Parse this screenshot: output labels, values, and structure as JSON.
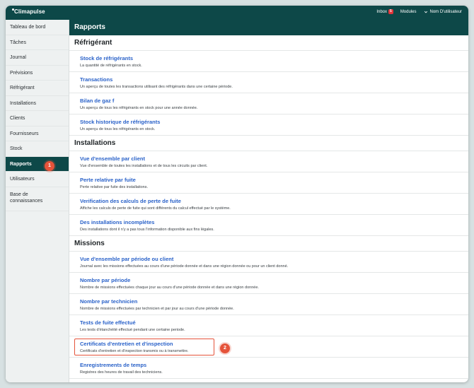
{
  "app": {
    "logo": "Climapulse"
  },
  "topnav": {
    "inbox_label": "Inbox",
    "inbox_count": "5",
    "modules_label": "Modules",
    "user_label": "Nom D'utilisateur"
  },
  "sidebar": {
    "items": [
      {
        "label": "Tableau de bord"
      },
      {
        "label": "Tâches"
      },
      {
        "label": "Journal"
      },
      {
        "label": "Prévisions"
      },
      {
        "label": "Réfrigérant"
      },
      {
        "label": "Installations"
      },
      {
        "label": "Clients"
      },
      {
        "label": "Fournisseurs"
      },
      {
        "label": "Stock"
      },
      {
        "label": "Rapports"
      },
      {
        "label": "Utilisateurs"
      },
      {
        "label_line1": "Base de",
        "label_line2": "connaissances"
      }
    ]
  },
  "markers": {
    "one": "1",
    "two": "2"
  },
  "main": {
    "title": "Rapports",
    "sections": [
      {
        "title": "Réfrigérant",
        "reports": [
          {
            "title": "Stock de réfrigérants",
            "desc": "La quantité de réfrigérants en stock."
          },
          {
            "title": "Transactions",
            "desc": "Un aperçu de toutes les transactions utilisant des réfrigérants dans une certaine période."
          },
          {
            "title": "Bilan de gaz f",
            "desc": "Un aperçu de tous les réfrigérants en stock pour une année donnée."
          },
          {
            "title": "Stock historique de réfrigérants",
            "desc": "Un aperçu de tous les réfrigérants en stock."
          }
        ]
      },
      {
        "title": "Installations",
        "reports": [
          {
            "title": "Vue d'ensemble par client",
            "desc": "Vue d'ensemble de toutes les installations et de tous les circuits par client."
          },
          {
            "title": "Perte relative par fuite",
            "desc": "Perte relative par fuite des installations."
          },
          {
            "title": "Verification des calculs de perte de fuite",
            "desc": "Affiche les calculs de perte de fuite qui sont différents du calcul effectué par le système."
          },
          {
            "title": "Des installations incomplètes",
            "desc": "Des installations dont il n'y a pas tous l'information disponible aux fins légales."
          }
        ]
      },
      {
        "title": "Missions",
        "reports": [
          {
            "title": "Vue d'ensemble par période ou client",
            "desc": "Journal avec les missions effectuées au cours d'une période donnée et dans une région donnée ou pour un client donné."
          },
          {
            "title": "Nombre par période",
            "desc": "Nombre de missions effectuées chaque jour au cours d'une période donnée et dans une région donnée."
          },
          {
            "title": "Nombre par technicien",
            "desc": "Nombre de missions effectuées par technicien et par jour au cours d'une période donnée."
          },
          {
            "title": "Tests de fuite effectué",
            "desc": "Les tests d'étanchéité effectué pendant une certaine periode."
          },
          {
            "title": "Certificats d'entretien et d'inspection",
            "desc": "Certificats d'entretien et d'inspection transmis ou à transmettre."
          },
          {
            "title": "Enregistrements de temps",
            "desc": "Registres des heures de travail des techniciens."
          }
        ]
      }
    ]
  },
  "colors": {
    "brand": "#0d4848",
    "link": "#2a62c9",
    "marker": "#e5533a",
    "badge": "#e0353a"
  }
}
